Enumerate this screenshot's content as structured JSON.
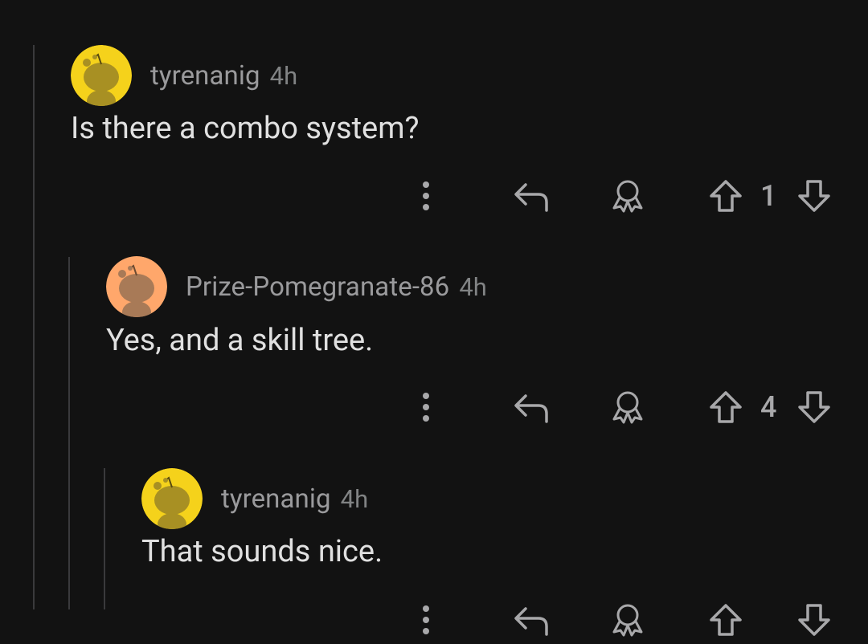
{
  "comments": [
    {
      "username": "tyrenanig",
      "time": "4h",
      "body": "Is there a combo system?",
      "avatar_color": "#f5d21b",
      "avatar_figure_color": "#a89023",
      "votes": "1",
      "icons": [
        "more-options-icon",
        "reply-icon",
        "award-icon",
        "upvote-icon",
        "downvote-icon"
      ]
    },
    {
      "username": "Prize-Pomegranate-86",
      "time": "4h",
      "body": "Yes, and a skill tree.",
      "avatar_color": "#ffa76b",
      "avatar_figure_color": "#a87a57",
      "votes": "4",
      "icons": [
        "more-options-icon",
        "reply-icon",
        "award-icon",
        "upvote-icon",
        "downvote-icon"
      ]
    },
    {
      "username": "tyrenanig",
      "time": "4h",
      "body": "That sounds nice.",
      "avatar_color": "#f5d21b",
      "avatar_figure_color": "#a89023",
      "votes": "",
      "icons": [
        "more-options-icon",
        "reply-icon",
        "award-icon",
        "upvote-icon",
        "downvote-icon"
      ]
    }
  ],
  "colors": {
    "background": "#121212",
    "thread_line": "#3a3a3c",
    "text": "#e0e0e0",
    "meta": "#9a9a9c",
    "icon": "#a8a8aa"
  }
}
